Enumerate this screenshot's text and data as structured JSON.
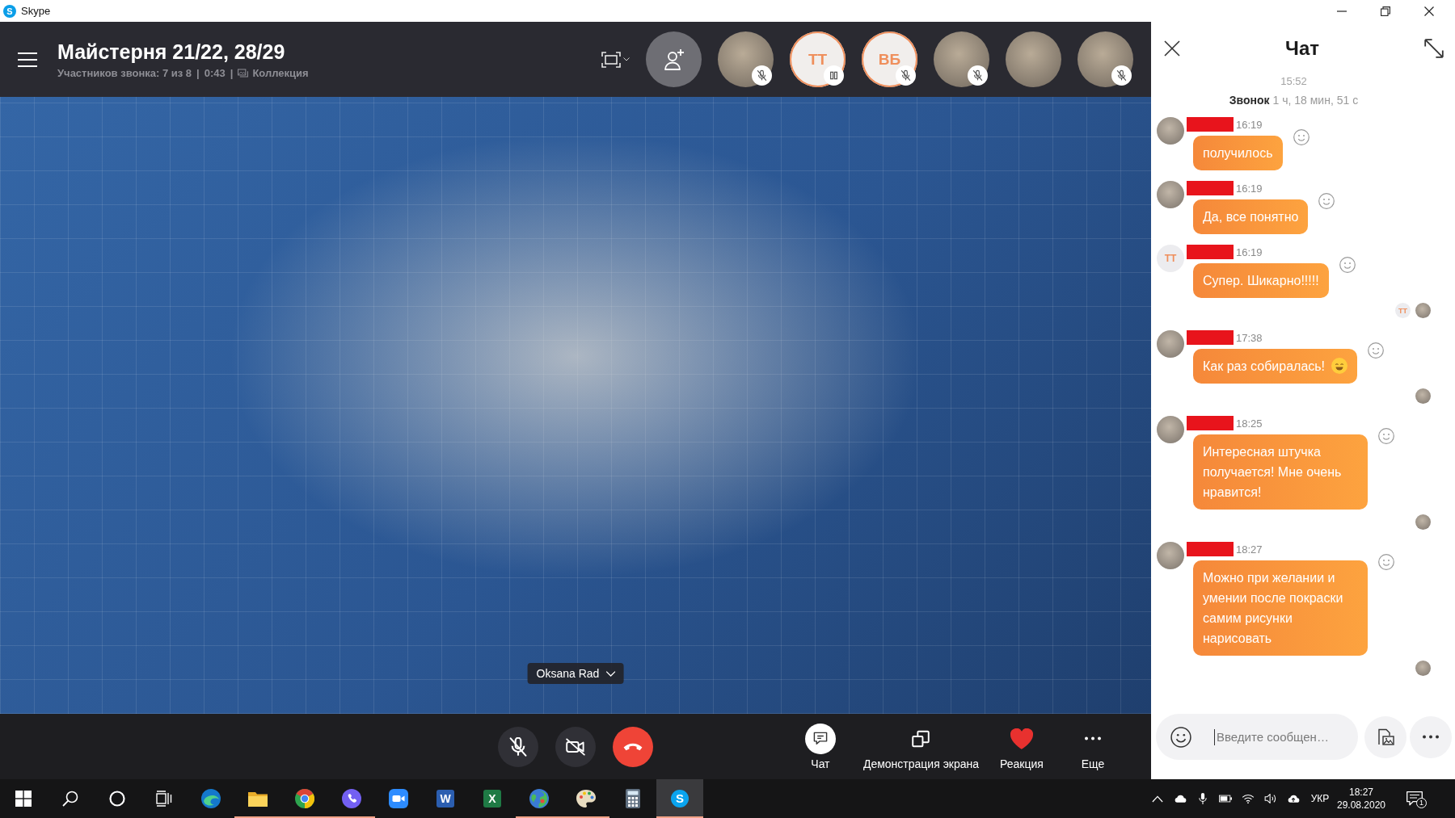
{
  "window": {
    "logo_glyph": "S",
    "title": "Skype"
  },
  "call_header": {
    "title": "Майстерня 21/22, 28/29",
    "subtitle": [
      {
        "kind": "text",
        "text": "Участников звонка: 7 из 8"
      },
      {
        "kind": "separator",
        "text": "|"
      },
      {
        "kind": "text",
        "text": "0:43"
      },
      {
        "kind": "separator",
        "text": "|"
      },
      {
        "kind": "link",
        "text": "Коллекция"
      }
    ]
  },
  "participants": [
    {
      "kind": "photo",
      "muted": true,
      "on_hold": false
    },
    {
      "kind": "initials",
      "initials": "ТТ",
      "muted": false,
      "on_hold": true
    },
    {
      "kind": "initials",
      "initials": "ВБ",
      "muted": true,
      "on_hold": false
    },
    {
      "kind": "photo",
      "muted": true,
      "on_hold": false
    },
    {
      "kind": "photo",
      "muted": false,
      "on_hold": false
    },
    {
      "kind": "photo",
      "muted": true,
      "on_hold": false
    }
  ],
  "video": {
    "speaker": "Oksana Rad"
  },
  "call_controls": {
    "mic_muted": true,
    "camera_off": true
  },
  "call_actions": [
    {
      "kind": "chat",
      "label": "Чат",
      "selected": true
    },
    {
      "kind": "share",
      "label": "Демонстрация экрана",
      "selected": false
    },
    {
      "kind": "reaction",
      "label": "Реакция",
      "selected": false
    },
    {
      "kind": "more",
      "label": "Еще",
      "selected": false
    }
  ],
  "chat": {
    "title": "Чат",
    "time_marker": "15:52",
    "call_summary": "**Звонок** 1 ч, 18 мин, 51 с",
    "messages": [
      {
        "avatar": {
          "kind": "photo"
        },
        "time": "16:19",
        "text": "получилось"
      },
      {
        "avatar": {
          "kind": "photo"
        },
        "time": "16:19",
        "text": "Да, все понятно"
      },
      {
        "avatar": {
          "kind": "initials",
          "initials": "ТТ"
        },
        "time": "16:19",
        "text": "Супер. Шикарно!!!!!",
        "read_by": [
          {
            "kind": "initials",
            "initials": "ТТ"
          },
          {
            "kind": "photo"
          }
        ]
      },
      {
        "avatar": {
          "kind": "photo"
        },
        "time": "17:38",
        "text": "Как раз собиралась!",
        "emoji": {
          "kind": "smile"
        },
        "read_by": [
          {
            "kind": "photo"
          }
        ]
      },
      {
        "avatar": {
          "kind": "photo"
        },
        "time": "18:25",
        "text": "Интересная штучка получается! Мне очень нравится!",
        "read_by": [
          {
            "kind": "photo"
          }
        ]
      },
      {
        "avatar": {
          "kind": "photo"
        },
        "time": "18:27",
        "text": "Можно при желании и умении после покраски самим рисунки нарисовать",
        "read_by": [
          {
            "kind": "photo"
          }
        ]
      }
    ],
    "input": {
      "placeholder": "Введите сообщен…"
    }
  },
  "taskbar": {
    "system": [
      {
        "kind": "start"
      },
      {
        "kind": "search"
      },
      {
        "kind": "cortana"
      },
      {
        "kind": "task_view"
      }
    ],
    "apps": [
      {
        "kind": "edge",
        "running": false,
        "selected": false
      },
      {
        "kind": "folder",
        "running": true,
        "selected": false
      },
      {
        "kind": "chrome",
        "running": true,
        "selected": false
      },
      {
        "kind": "viber",
        "running": true,
        "selected": false
      },
      {
        "kind": "zoom",
        "running": false,
        "selected": false
      },
      {
        "kind": "word",
        "glyph": "W",
        "running": false,
        "selected": false
      },
      {
        "kind": "excel",
        "glyph": "X",
        "running": false,
        "selected": false
      },
      {
        "kind": "globe",
        "running": true,
        "selected": false
      },
      {
        "kind": "palette",
        "running": true,
        "selected": false
      },
      {
        "kind": "calculator",
        "running": false,
        "selected": false
      },
      {
        "kind": "skype",
        "glyph": "S",
        "running": true,
        "selected": true
      }
    ],
    "tray": {
      "icons": [
        {
          "kind": "chevron"
        },
        {
          "kind": "cloud"
        },
        {
          "kind": "mic"
        },
        {
          "kind": "battery"
        },
        {
          "kind": "wifi"
        },
        {
          "kind": "volume"
        },
        {
          "kind": "upload"
        }
      ],
      "language": "УКР",
      "time": "18:27",
      "date": "29.08.2020",
      "notification_count": "1"
    }
  }
}
